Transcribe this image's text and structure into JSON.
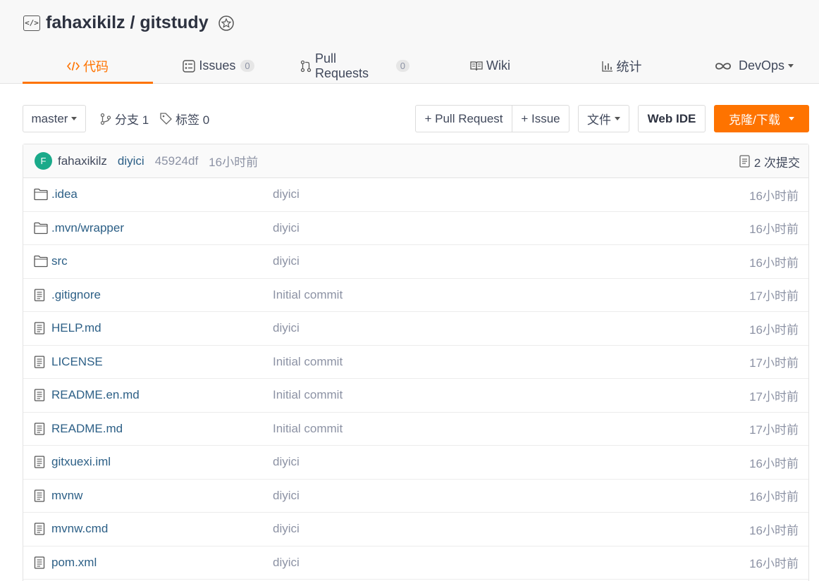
{
  "repo": {
    "owner": "fahaxikilz",
    "name": "gitstudy",
    "full_name": "fahaxikilz / gitstudy"
  },
  "tabs": [
    {
      "label": "代码",
      "icon": "code-icon",
      "active": true
    },
    {
      "label": "Issues",
      "icon": "issues-icon",
      "count": "0"
    },
    {
      "label": "Pull Requests",
      "icon": "pull-request-icon",
      "count": "0"
    },
    {
      "label": "Wiki",
      "icon": "wiki-icon"
    },
    {
      "label": "统计",
      "icon": "stats-icon"
    },
    {
      "label": "DevOps",
      "icon": "devops-icon"
    }
  ],
  "toolbar": {
    "branch": "master",
    "branches": "分支 1",
    "tags": "标签 0",
    "pull_request": "+ Pull Request",
    "issue": "+ Issue",
    "file": "文件",
    "web_ide": "Web IDE",
    "clone": "克隆/下载"
  },
  "commit": {
    "avatar_letter": "F",
    "author": "fahaxikilz",
    "message": "diyici",
    "sha": "45924df",
    "time": "16小时前",
    "count": "2 次提交"
  },
  "files": [
    {
      "name": ".idea",
      "type": "folder",
      "message": "diyici",
      "time": "16小时前"
    },
    {
      "name": ".mvn/wrapper",
      "type": "folder",
      "message": "diyici",
      "time": "16小时前"
    },
    {
      "name": "src",
      "type": "folder",
      "message": "diyici",
      "time": "16小时前"
    },
    {
      "name": ".gitignore",
      "type": "file",
      "message": "Initial commit",
      "time": "17小时前"
    },
    {
      "name": "HELP.md",
      "type": "file",
      "message": "diyici",
      "time": "16小时前"
    },
    {
      "name": "LICENSE",
      "type": "file",
      "message": "Initial commit",
      "time": "17小时前"
    },
    {
      "name": "README.en.md",
      "type": "file",
      "message": "Initial commit",
      "time": "17小时前"
    },
    {
      "name": "README.md",
      "type": "file",
      "message": "Initial commit",
      "time": "17小时前"
    },
    {
      "name": "gitxuexi.iml",
      "type": "file",
      "message": "diyici",
      "time": "16小时前"
    },
    {
      "name": "mvnw",
      "type": "file",
      "message": "diyici",
      "time": "16小时前"
    },
    {
      "name": "mvnw.cmd",
      "type": "file",
      "message": "diyici",
      "time": "16小时前"
    },
    {
      "name": "pom.xml",
      "type": "file",
      "message": "diyici",
      "time": "16小时前"
    }
  ],
  "colors": {
    "accent": "#fe7300",
    "link": "#2c5f86",
    "muted": "#8c92a4",
    "avatar": "#1aaa8a"
  }
}
